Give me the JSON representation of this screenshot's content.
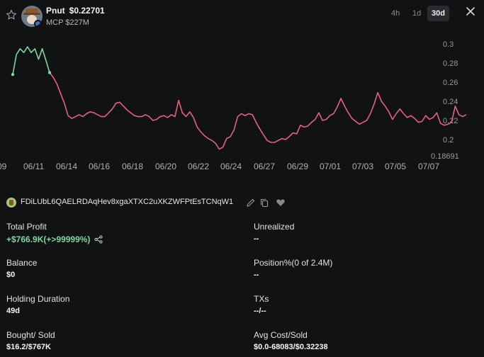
{
  "header": {
    "token_symbol": "Pnut",
    "price": "$0.22701",
    "mcp": "MCP $227M",
    "timeframes": [
      "4h",
      "1d",
      "30d"
    ],
    "active_timeframe": "30d"
  },
  "chart_data": {
    "type": "line",
    "x_tick_labels": [
      "09",
      "06/11",
      "06/14",
      "06/16",
      "06/18",
      "06/20",
      "06/22",
      "06/24",
      "06/27",
      "06/29",
      "07/01",
      "07/03",
      "07/05",
      "07/07"
    ],
    "y_tick_labels": [
      "0.3",
      "0.28",
      "0.26",
      "0.24",
      "0.22",
      "0.2",
      "0.18691"
    ],
    "ylim": [
      0.18691,
      0.3
    ],
    "series": [
      {
        "color_early": "#7fd6a0",
        "color_late": "#e8607a",
        "values": [
          0.268,
          0.289,
          0.295,
          0.291,
          0.297,
          0.291,
          0.295,
          0.284,
          0.295,
          0.283,
          0.27,
          0.265,
          0.258,
          0.248,
          0.238,
          0.225,
          0.222,
          0.224,
          0.226,
          0.224,
          0.227,
          0.229,
          0.228,
          0.226,
          0.224,
          0.224,
          0.228,
          0.232,
          0.238,
          0.239,
          0.235,
          0.231,
          0.228,
          0.225,
          0.224,
          0.224,
          0.226,
          0.224,
          0.22,
          0.221,
          0.224,
          0.225,
          0.223,
          0.226,
          0.224,
          0.241,
          0.228,
          0.224,
          0.229,
          0.223,
          0.213,
          0.208,
          0.204,
          0.201,
          0.199,
          0.196,
          0.19,
          0.192,
          0.201,
          0.203,
          0.21,
          0.224,
          0.227,
          0.225,
          0.227,
          0.226,
          0.218,
          0.211,
          0.205,
          0.199,
          0.197,
          0.197,
          0.199,
          0.201,
          0.2,
          0.203,
          0.207,
          0.206,
          0.215,
          0.213,
          0.214,
          0.218,
          0.221,
          0.228,
          0.22,
          0.221,
          0.225,
          0.227,
          0.234,
          0.243,
          0.235,
          0.228,
          0.222,
          0.219,
          0.216,
          0.218,
          0.22,
          0.227,
          0.237,
          0.249,
          0.24,
          0.235,
          0.229,
          0.221,
          0.227,
          0.232,
          0.227,
          0.223,
          0.225,
          0.222,
          0.218,
          0.219,
          0.225,
          0.221,
          0.223,
          0.228,
          0.217,
          0.215,
          0.216,
          0.218,
          0.235,
          0.226,
          0.224,
          0.226
        ]
      }
    ]
  },
  "wallet": {
    "address": "FDiLUbL6QAELRDAqHev8xgaXTXC2uXKZWFPtEsTCNqW1"
  },
  "stats": {
    "total_profit_label": "Total Profit",
    "total_profit_value": "+$766.9K(+>99999%)",
    "unrealized_label": "Unrealized",
    "unrealized_value": "--",
    "balance_label": "Balance",
    "balance_value": "$0",
    "position_label": "Position%(0 of 2.4M)",
    "position_value": "--",
    "holding_label": "Holding Duration",
    "holding_value": "49d",
    "txs_label": "TXs",
    "txs_value": "--/--",
    "bought_sold_label": "Bought/ Sold",
    "bought_sold_value": "$16.2/$767K",
    "avg_cost_label": "Avg Cost/Sold",
    "avg_cost_value": "$0.0-68083/$0.32238"
  },
  "icons": {
    "star": "star-icon",
    "close": "close-icon",
    "edit": "pencil-icon",
    "copy": "copy-icon",
    "heart": "heart-icon",
    "share": "share-icon"
  }
}
